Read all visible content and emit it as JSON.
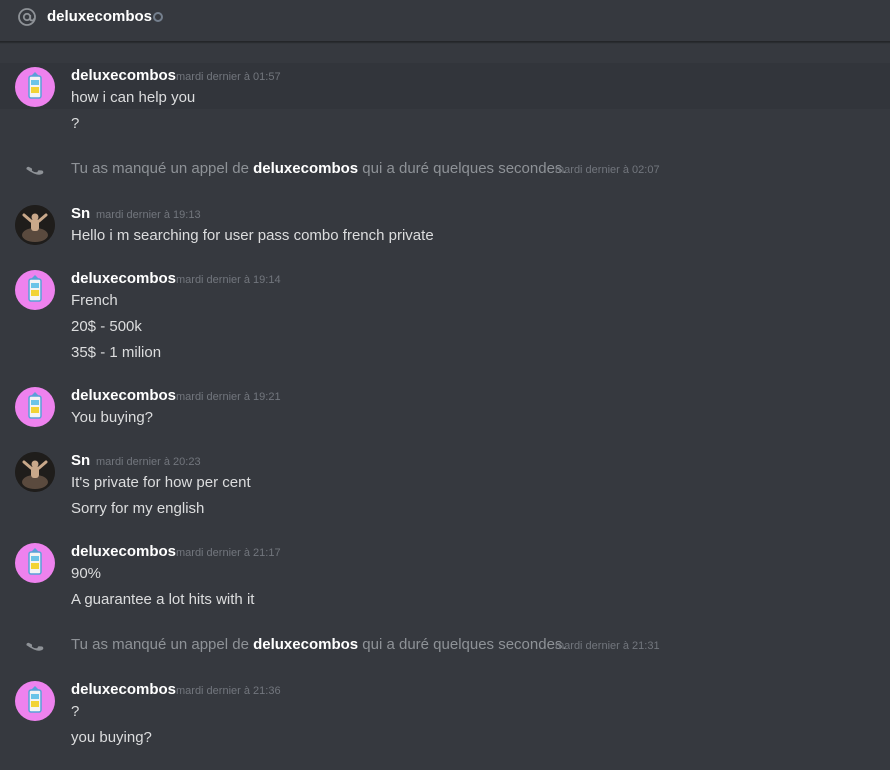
{
  "header": {
    "title": "deluxecombos",
    "icon": "at-icon",
    "status": "offline"
  },
  "colors": {
    "background": "#36393f",
    "highlight": "#32353b",
    "avatar_pink": "#ee82ee",
    "username": "#ffffff",
    "timestamp": "#72767d",
    "text": "#dcddde",
    "system_text": "#8e9297"
  },
  "groups": [
    {
      "author": "deluxecombos",
      "time": "mardi dernier à 01:57",
      "lines": [
        "how i can help you",
        "?"
      ]
    },
    {
      "system": true,
      "prefix": "Tu as manqué un appel de ",
      "name": "deluxecombos",
      "suffix": " qui a duré quelques secondes.",
      "time": "mardi dernier à 02:07"
    },
    {
      "author": "Sn",
      "time": "mardi dernier à 19:13",
      "lines": [
        "Hello i m searching for user pass combo french private"
      ]
    },
    {
      "author": "deluxecombos",
      "time": "mardi dernier à 19:14",
      "lines": [
        "French",
        "20$ - 500k",
        "35$ - 1 milion"
      ]
    },
    {
      "author": "deluxecombos",
      "time": "mardi dernier à 19:21",
      "lines": [
        "You buying?"
      ]
    },
    {
      "author": "Sn",
      "time": "mardi dernier à 20:23",
      "lines": [
        "It's private for how per cent",
        "Sorry for my english"
      ]
    },
    {
      "author": "deluxecombos",
      "time": "mardi dernier à 21:17",
      "lines": [
        "90%",
        "A guarantee a lot hits with it"
      ]
    },
    {
      "system": true,
      "prefix": "Tu as manqué un appel de ",
      "name": "deluxecombos",
      "suffix": " qui a duré quelques secondes.",
      "time": "mardi dernier à 21:31"
    },
    {
      "author": "deluxecombos",
      "time": "mardi dernier à 21:36",
      "lines": [
        "?",
        "you buying?"
      ]
    }
  ]
}
